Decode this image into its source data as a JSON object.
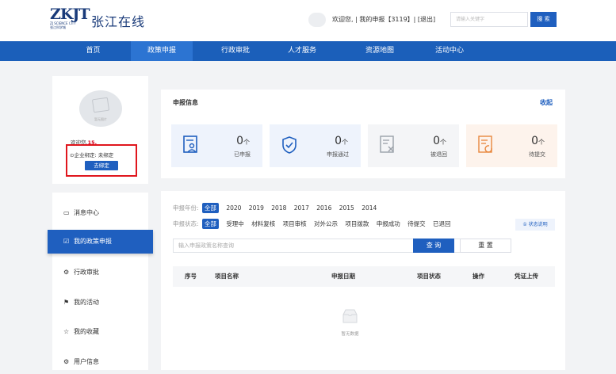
{
  "header": {
    "logo_mark": "ZKJT",
    "logo_sub_en": "ZJ SCIENCE CITY",
    "logo_sub_cn": "张江科学城",
    "site_title": "张江在线",
    "welcome_links": "欢迎您, | 我的申报【3119】| [退出]",
    "search_placeholder": "请输入关键字",
    "search_button": "搜 索"
  },
  "nav": {
    "items": [
      {
        "label": "首页"
      },
      {
        "label": "政策申报"
      },
      {
        "label": "行政审批"
      },
      {
        "label": "人才服务"
      },
      {
        "label": "资源地图"
      },
      {
        "label": "活动中心"
      }
    ]
  },
  "profile": {
    "avatar_caption": "暂无图片",
    "welcome_prefix": "欢迎您,",
    "welcome_name": "15.",
    "bind_status": "企业绑定: 未绑定",
    "bind_button": "去绑定"
  },
  "menu": {
    "items": [
      {
        "label": "消息中心",
        "icon": "message-icon"
      },
      {
        "label": "我的政策申报",
        "icon": "edit-icon"
      },
      {
        "label": "行政审批",
        "icon": "gear-icon"
      },
      {
        "label": "我的活动",
        "icon": "flag-icon"
      },
      {
        "label": "我的收藏",
        "icon": "star-icon"
      },
      {
        "label": "用户信息",
        "icon": "user-gear-icon"
      }
    ]
  },
  "info": {
    "title": "申报信息",
    "collapse": "收起",
    "cards": [
      {
        "value": "0",
        "unit": "个",
        "label": "已申报",
        "icon": "person-doc-icon",
        "bg": "#eef3fc",
        "color": "#1f5fbf"
      },
      {
        "value": "0",
        "unit": "个",
        "label": "申报通过",
        "icon": "shield-check-icon",
        "bg": "#eef3fc",
        "color": "#1f5fbf"
      },
      {
        "value": "0",
        "unit": "个",
        "label": "被退回",
        "icon": "doc-x-icon",
        "bg": "#f4f5f7",
        "color": "#9aa0a8"
      },
      {
        "value": "0",
        "unit": "个",
        "label": "待提交",
        "icon": "doc-refresh-icon",
        "bg": "#fdf3ec",
        "color": "#e8873e"
      }
    ]
  },
  "filters": {
    "year_label": "申报年份:",
    "years": [
      "全部",
      "2020",
      "2019",
      "2018",
      "2017",
      "2016",
      "2015",
      "2014"
    ],
    "status_label": "申报状态:",
    "statuses": [
      "全部",
      "受理中",
      "材料复核",
      "项目审核",
      "对外公示",
      "项目拨款",
      "申报成功",
      "待提交",
      "已退回"
    ],
    "status_tip": "① 状态说明",
    "search_placeholder": "输入申报政策名称查询",
    "query_button": "查 询",
    "reset_button": "重 置"
  },
  "table": {
    "columns": [
      "序号",
      "项目名称",
      "申报日期",
      "项目状态",
      "操作",
      "凭证上传"
    ],
    "empty_text": "暂无数据"
  }
}
